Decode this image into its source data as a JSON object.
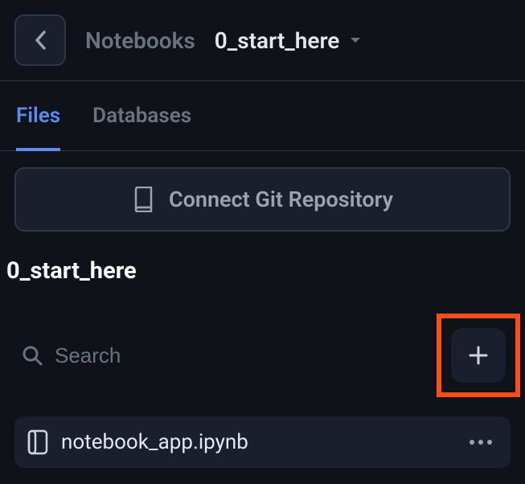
{
  "breadcrumb": {
    "root": "Notebooks",
    "current": "0_start_here"
  },
  "tabs": {
    "files": "Files",
    "databases": "Databases"
  },
  "connect_git": "Connect Git Repository",
  "folder_title": "0_start_here",
  "search": {
    "placeholder": "Search"
  },
  "files": [
    {
      "name": "notebook_app.ipynb"
    }
  ]
}
